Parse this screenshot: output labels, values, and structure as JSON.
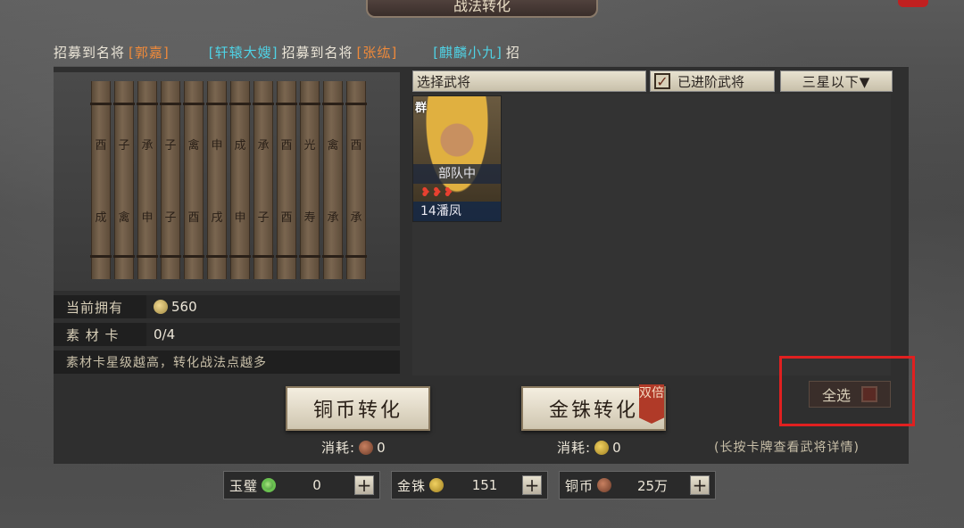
{
  "window": {
    "title": "战法转化"
  },
  "marquee": [
    {
      "text": "招募到名将",
      "color": "white"
    },
    {
      "text": "[郭嘉]",
      "color": "orange"
    },
    {
      "text": "[轩辕大嫂]",
      "color": "cyan"
    },
    {
      "text": "招募到名将",
      "color": "white"
    },
    {
      "text": "[张纮]",
      "color": "orange"
    },
    {
      "text": "[麒麟小九]",
      "color": "cyan"
    },
    {
      "text": "招",
      "color": "white"
    }
  ],
  "left_panel": {
    "owned_label": "当前拥有",
    "owned_value": "560",
    "material_label": "素 材 卡",
    "material_value": "0/4",
    "hint": "素材卡星级越高，转化战法点越多",
    "scroll_chars": [
      "酉",
      "子",
      "承",
      "子",
      "禽",
      "申",
      "成",
      "承",
      "酉",
      "光",
      "成",
      "禽",
      "申",
      "子",
      "酉",
      "戌",
      "申",
      "子",
      "酉",
      "寿"
    ]
  },
  "filter": {
    "select_label": "选择武将",
    "advanced_label": "已进阶武将",
    "advanced_checked_mark": "✓",
    "star_filter": "三星以下▼"
  },
  "cards": [
    {
      "faction": "群",
      "status": "部队中",
      "stars": "❥❥❥",
      "level_name": "14潘凤"
    }
  ],
  "actions": {
    "copper_convert": "铜币转化",
    "gold_convert": "金铢转化",
    "double_tag": "双倍",
    "cost_label": "消耗:",
    "copper_cost": "0",
    "gold_cost": "0",
    "hold_hint": "(长按卡牌查看武将详情)",
    "select_all": "全选"
  },
  "currencies": [
    {
      "name": "玉璧",
      "value": "0",
      "icon": "jade-icon"
    },
    {
      "name": "金铢",
      "value": "151",
      "icon": "gold-coin-icon"
    },
    {
      "name": "铜币",
      "value": "25万",
      "icon": "copper-coin-icon"
    }
  ],
  "plus_label": "+"
}
